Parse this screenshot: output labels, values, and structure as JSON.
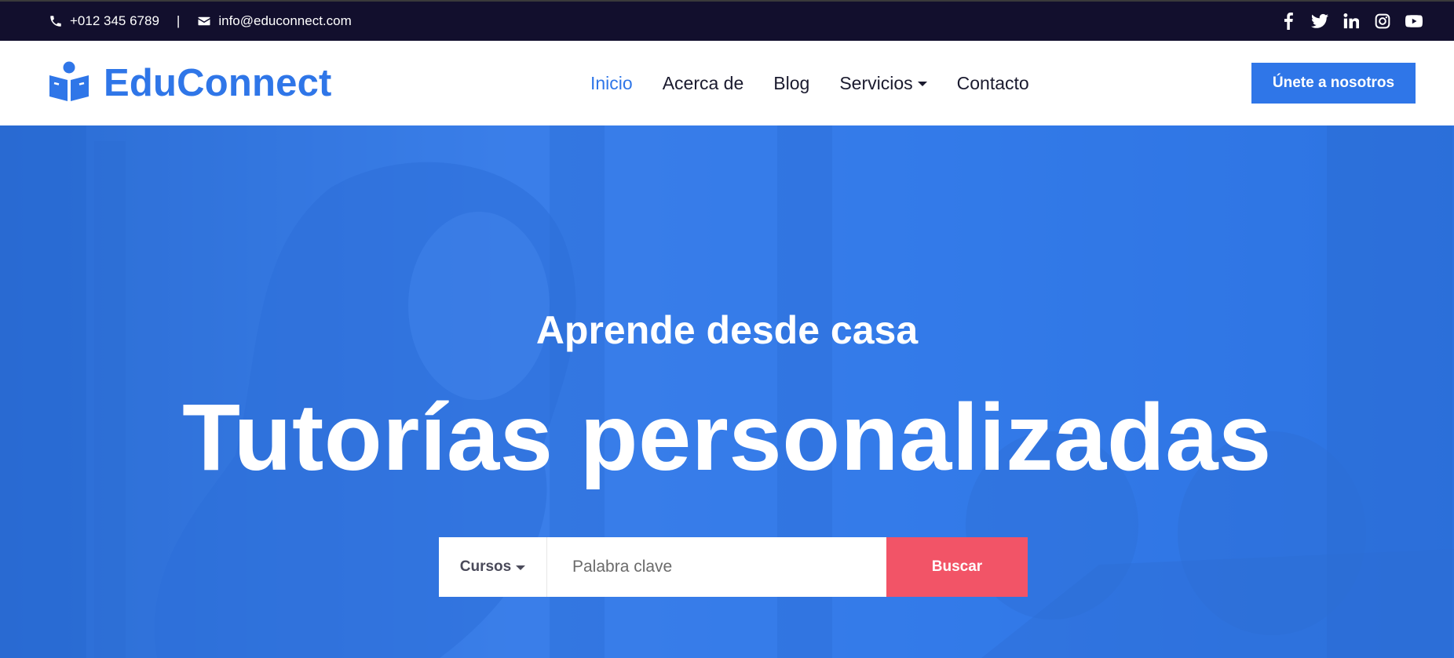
{
  "topbar": {
    "phone": "+012 345 6789",
    "separator": "|",
    "email": "info@educonnect.com",
    "social": [
      "facebook-icon",
      "twitter-icon",
      "linkedin-icon",
      "instagram-icon",
      "youtube-icon"
    ]
  },
  "brand": {
    "name": "EduConnect",
    "icon": "reader-book-icon",
    "color": "#2f76e8"
  },
  "nav": {
    "items": [
      {
        "label": "Inicio",
        "active": true
      },
      {
        "label": "Acerca de"
      },
      {
        "label": "Blog"
      },
      {
        "label": "Servicios",
        "dropdown": true
      },
      {
        "label": "Contacto"
      }
    ],
    "cta": "Únete a nosotros"
  },
  "hero": {
    "subtitle": "Aprende desde casa",
    "title": "Tutorías personalizadas",
    "search": {
      "category": "Cursos",
      "placeholder": "Palabra clave",
      "button": "Buscar"
    }
  },
  "colors": {
    "primary": "#2f76e8",
    "topbar": "#120f2d",
    "search_button": "#f25467"
  }
}
